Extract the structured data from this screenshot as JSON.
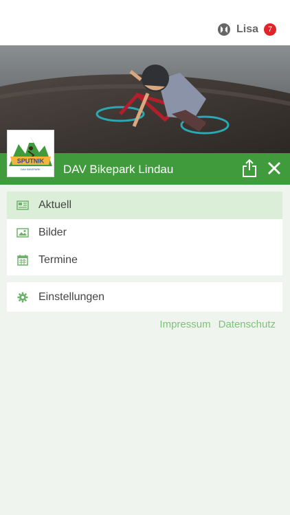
{
  "user": {
    "name": "Lisa",
    "notifications": "7"
  },
  "header": {
    "title": "DAV Bikepark Lindau"
  },
  "logo": {
    "text": "SPUTNIK",
    "subtext": "DAV BIKEPARK",
    "icon": "mountain-biker-logo"
  },
  "menu": {
    "items": [
      {
        "label": "Aktuell",
        "icon": "newspaper-icon"
      },
      {
        "label": "Bilder",
        "icon": "image-icon"
      },
      {
        "label": "Termine",
        "icon": "calendar-icon"
      }
    ],
    "settings": {
      "label": "Einstellungen",
      "icon": "gear-icon"
    }
  },
  "footer": {
    "impressum": "Impressum",
    "datenschutz": "Datenschutz"
  },
  "colors": {
    "brand": "#3f9b3b",
    "active_bg": "#dbeed8",
    "icon": "#6db06a",
    "badge": "#e2232a",
    "link": "#7fbf7b",
    "page_bg": "#eff5ee"
  }
}
